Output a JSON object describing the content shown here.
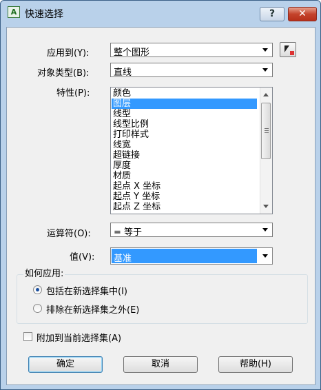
{
  "window": {
    "title": "快速选择",
    "help_glyph": "?",
    "close_glyph": "✕",
    "icon": "autocad-icon"
  },
  "apply_to": {
    "label": "应用到(Y):",
    "value": "整个图形"
  },
  "object_type": {
    "label": "对象类型(B):",
    "value": "直线"
  },
  "properties": {
    "label": "特性(P):",
    "items": [
      "颜色",
      "图层",
      "线型",
      "线型比例",
      "打印样式",
      "线宽",
      "超链接",
      "厚度",
      "材质",
      "起点 X 坐标",
      "起点 Y 坐标",
      "起点 Z 坐标"
    ],
    "selected_index": 1
  },
  "operator": {
    "label": "运算符(O):",
    "value": "= 等于"
  },
  "value": {
    "label": "值(V):",
    "value": "基准"
  },
  "how_to_apply": {
    "title": "如何应用:",
    "include": {
      "label": "包括在新选择集中(I)",
      "checked": true
    },
    "exclude": {
      "label": "排除在新选择集之外(E)",
      "checked": false
    }
  },
  "append": {
    "label": "附加到当前选择集(A)",
    "checked": false
  },
  "buttons": {
    "ok": "确定",
    "cancel": "取消",
    "help": "帮助(H)"
  },
  "colors": {
    "titlebar": "#b9d1ea",
    "selection": "#3399ff",
    "close": "#c4432b"
  }
}
